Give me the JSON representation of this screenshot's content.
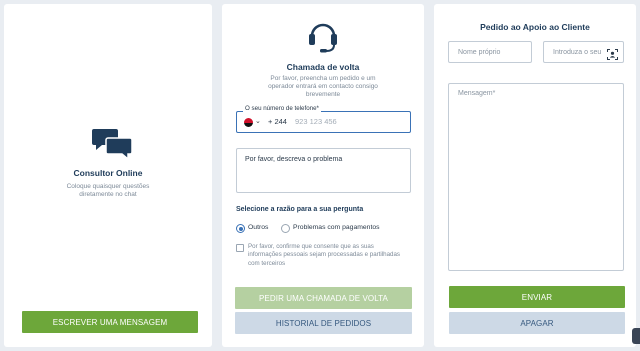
{
  "online": {
    "title": "Consultor Online",
    "subtitle": "Coloque quaisquer questões diretamente no chat",
    "write_button": "ESCREVER UMA MENSAGEM",
    "icon": "chat-bubbles-icon"
  },
  "callback": {
    "icon": "headset-icon",
    "title": "Chamada de volta",
    "subtitle": "Por favor, preencha um pedido e um operador entrará em contacto consigo brevemente",
    "phone_label": "O seu número de telefone*",
    "dial_code": "+ 244",
    "phone_placeholder": "923 123 456",
    "description_placeholder": "Por favor, descreva o problema",
    "reason_title": "Selecione a razão para a sua pergunta",
    "reasons": [
      {
        "label": "Outros",
        "selected": true
      },
      {
        "label": "Problemas com pagamentos",
        "selected": false
      }
    ],
    "consent": "Por favor, confirme que consente que as suas informações pessoais sejam processadas e partilhadas com terceiros",
    "request_button": "PEDIR UMA CHAMADA DE VOLTA",
    "history_button": "HISTORIAL DE PEDIDOS"
  },
  "support": {
    "title": "Pedido ao Apoio ao Cliente",
    "name_placeholder": "Nome próprio",
    "email_placeholder": "Introduza o seu",
    "message_placeholder": "Mensagem*",
    "send_button": "ENVIAR",
    "clear_button": "APAGAR"
  },
  "colors": {
    "accent_green": "#6da73a",
    "accent_blue": "#3a72b6",
    "title_navy": "#1f3c5a"
  }
}
